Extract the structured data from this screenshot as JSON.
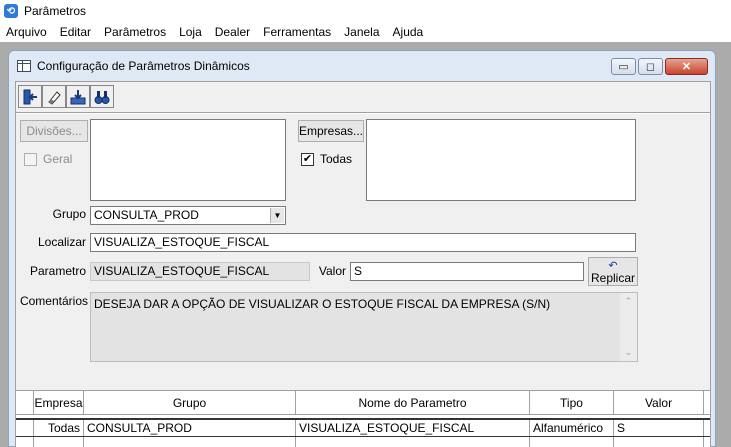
{
  "app": {
    "title": "Parâmetros",
    "menu": [
      "Arquivo",
      "Editar",
      "Parâmetros",
      "Loja",
      "Dealer",
      "Ferramentas",
      "Janela",
      "Ajuda"
    ]
  },
  "window": {
    "title": "Configuração de Parâmetros Dinâmicos",
    "controls": {
      "minimize": "▭",
      "restore": "◻",
      "close": "✕"
    }
  },
  "toolbar": {
    "icons": [
      "exit-icon",
      "eraser-icon",
      "save-icon",
      "binoculars-icon"
    ]
  },
  "form": {
    "divisoes_button": "Divisões...",
    "geral_label": "Geral",
    "geral_checked": false,
    "empresas_button": "Empresas...",
    "todas_label": "Todas",
    "todas_checked": true,
    "grupo_label": "Grupo",
    "grupo_value": "CONSULTA_PROD",
    "localizar_label": "Localizar",
    "localizar_value": "VISUALIZA_ESTOQUE_FISCAL",
    "parametro_label": "Parametro",
    "parametro_value": "VISUALIZA_ESTOQUE_FISCAL",
    "valor_label": "Valor",
    "valor_value": "S",
    "replicar_button": "Replicar",
    "comentarios_label": "Comentários",
    "comentarios_value": "DESEJA DAR A OPÇÃO DE VISUALIZAR O ESTOQUE FISCAL DA EMPRESA (S/N)"
  },
  "grid": {
    "columns": [
      "Empresa",
      "Grupo",
      "Nome do Parametro",
      "Tipo",
      "Valor"
    ],
    "rows": [
      [
        "Todas",
        "CONSULTA_PROD",
        "VISUALIZA_ESTOQUE_FISCAL",
        "Alfanumérico",
        "S"
      ]
    ]
  }
}
